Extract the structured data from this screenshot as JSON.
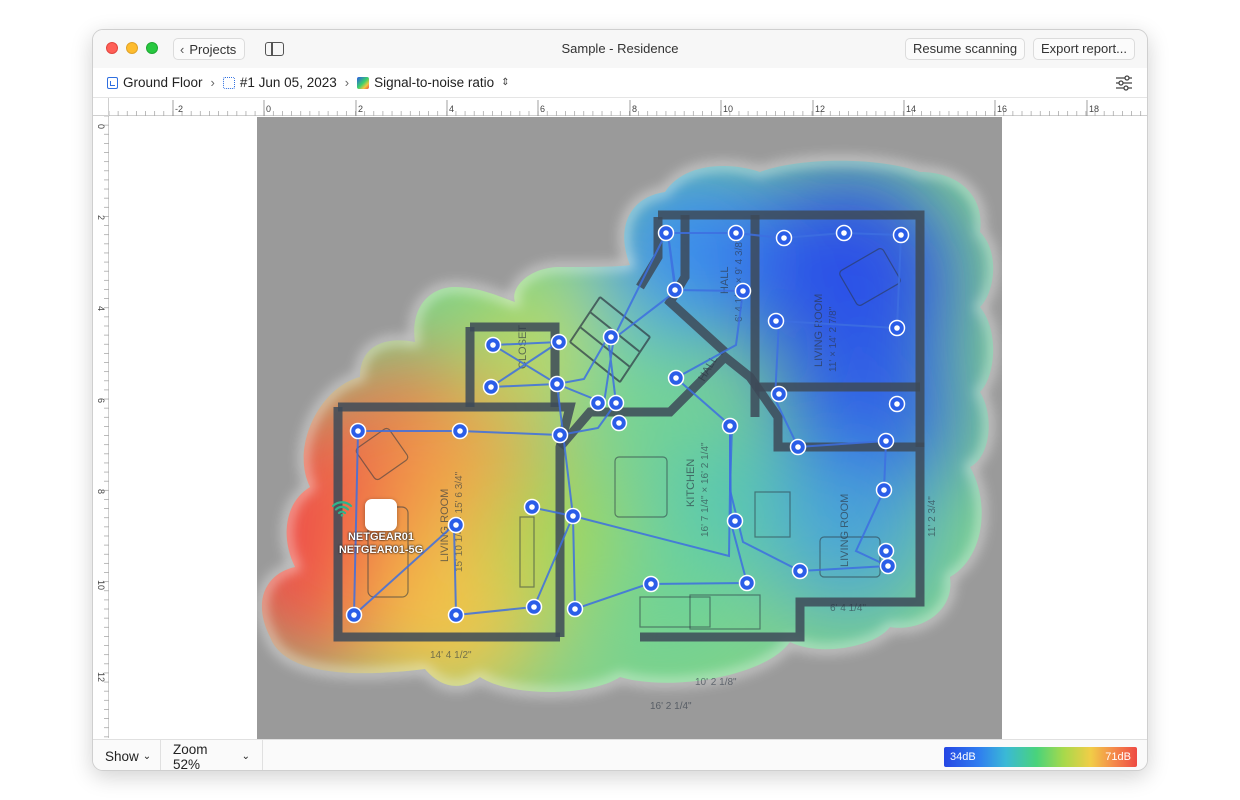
{
  "window": {
    "title": "Sample - Residence"
  },
  "toolbar": {
    "back_label": "Projects",
    "resume_label": "Resume scanning",
    "export_label": "Export report..."
  },
  "breadcrumb": {
    "floor": "Ground Floor",
    "scan": "#1 Jun 05, 2023",
    "metric": "Signal-to-noise ratio"
  },
  "rulers": {
    "horizontal": [
      "-2",
      "0",
      "2",
      "4",
      "6",
      "8",
      "10",
      "12",
      "14",
      "16",
      "18"
    ],
    "vertical": [
      "0",
      "2",
      "4",
      "6",
      "8",
      "10",
      "12"
    ]
  },
  "floorplan": {
    "rooms": [
      "LIVING ROOM",
      "CLOSET",
      "HALL",
      "HALL",
      "KITCHEN",
      "LIVING ROOM",
      "LIVING ROOM"
    ],
    "dimensions": [
      "15' 10 1/4\" × 15' 6 3/4\"",
      "16' 7 1/4\" × 16' 2 1/4\"",
      "11' × 14' 2 7/8\"",
      "6' 4 1/4\" × 9' 4 3/8\"",
      "14' 4 1/2\"",
      "16' 2 1/4\"",
      "10' 2 1/8\"",
      "6' 4 1/4\"",
      "11' 2 3/4\""
    ]
  },
  "access_point": {
    "names": [
      "NETGEAR01",
      "NETGEAR01-5G"
    ],
    "icon": "wifi-icon"
  },
  "bottom": {
    "show_label": "Show",
    "zoom_label": "Zoom 52%"
  },
  "legend": {
    "min_label": "34dB",
    "max_label": "71dB",
    "colors": [
      "#2546e4",
      "#2f7df0",
      "#3ab9d6",
      "#49d37b",
      "#a7d94b",
      "#f1cd47",
      "#f4894a",
      "#ee4a44"
    ]
  }
}
